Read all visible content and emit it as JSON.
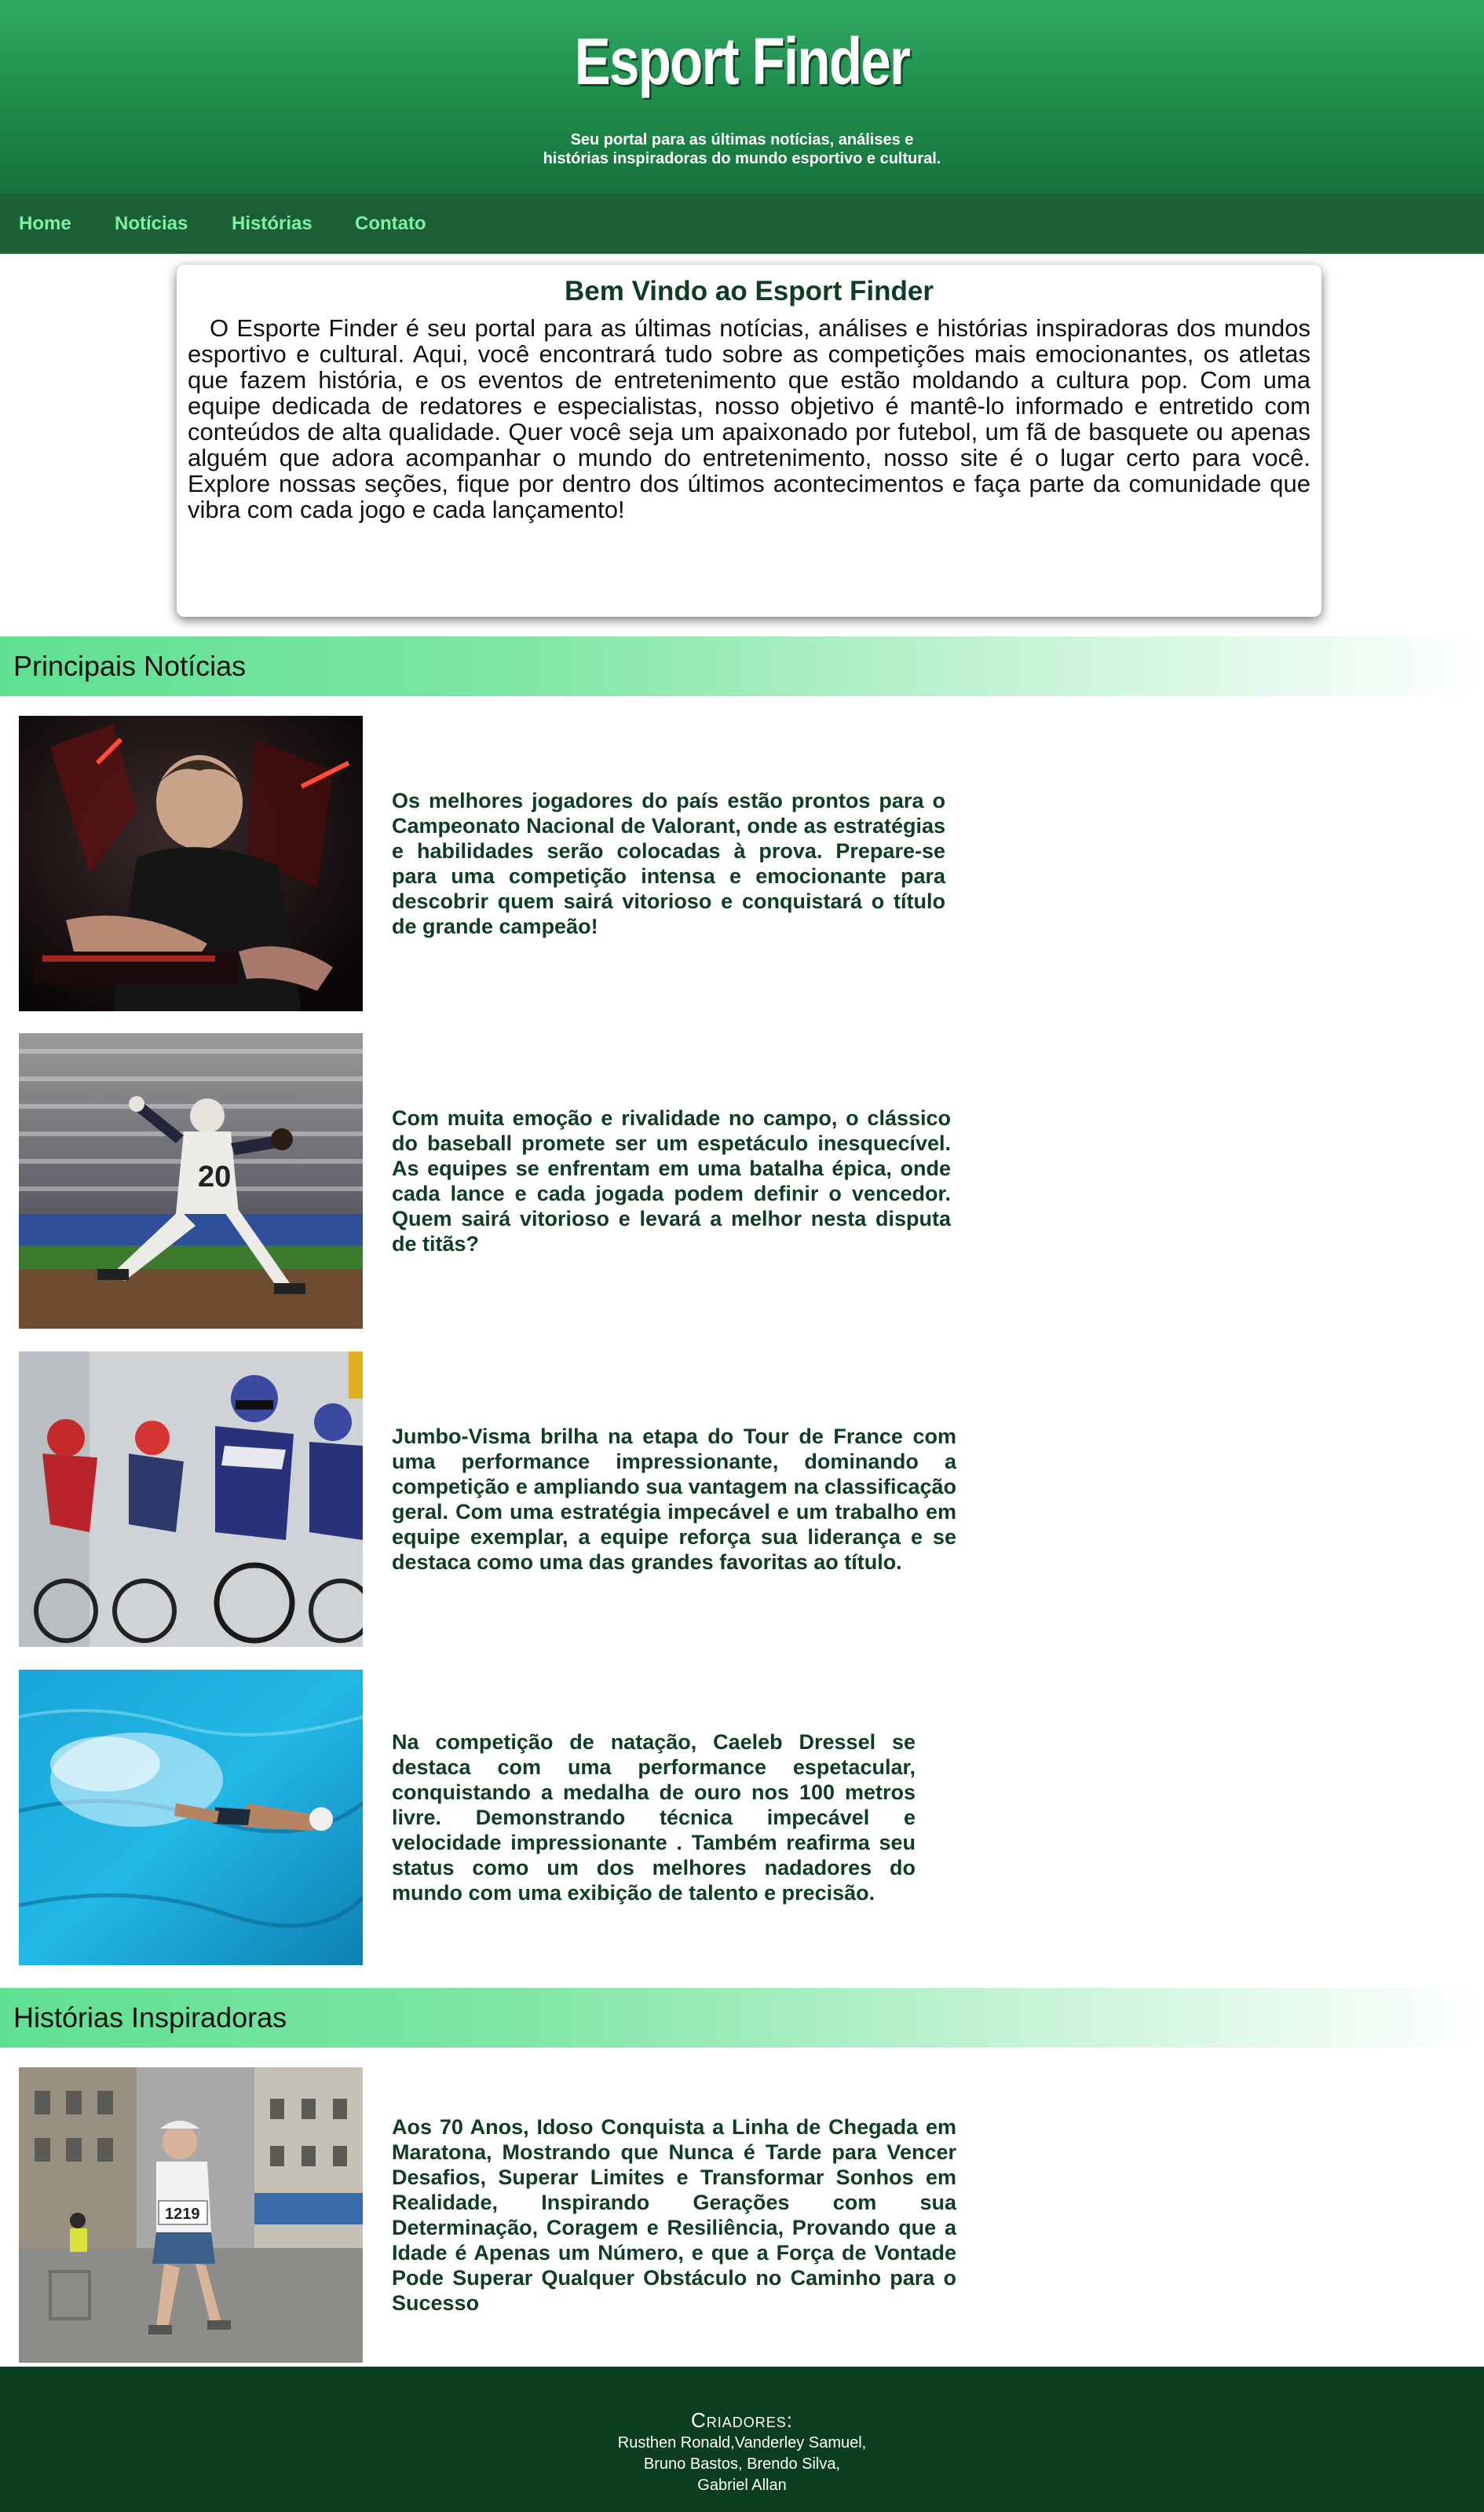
{
  "header": {
    "brand": "Esport Finder",
    "tagline_line1": "Seu portal para as últimas notícias, análises e",
    "tagline_line2": "histórias inspiradoras do mundo esportivo e cultural."
  },
  "nav": {
    "items": [
      "Home",
      "Notícias",
      "Histórias",
      "Contato"
    ]
  },
  "welcome": {
    "title": "Bem Vindo ao Esport Finder",
    "body": "O Esporte Finder é seu portal para as últimas notícias, análises e histórias inspiradoras dos mundos esportivo e cultural. Aqui, você encontrará tudo sobre as competições mais emocionantes, os atletas que fazem história, e os eventos de entretenimento que estão moldando a cultura pop. Com uma equipe dedicada de redatores e especialistas, nosso objetivo é mantê-lo informado e entretido com conteúdos de alta qualidade. Quer você seja um apaixonado por futebol, um fã de basquete ou apenas alguém que adora acompanhar o mundo do entretenimento, nosso site é o lugar certo para você. Explore nossas seções, fique por dentro dos últimos acontecimentos e faça parte da comunidade que vibra com cada jogo e cada lançamento!"
  },
  "news": {
    "title": "Principais Notícias",
    "items": [
      {
        "image": "esports-gamer-photo",
        "text": "Os melhores jogadores do país estão prontos para o Campeonato Nacional de Valorant, onde as estratégias e habilidades serão colocadas à prova. Prepare-se para uma competição intensa e emocionante para descobrir quem sairá vitorioso e conquistará o título de grande campeão!"
      },
      {
        "image": "baseball-pitcher-photo",
        "text": "Com muita emoção e rivalidade no campo, o clássico do baseball promete ser um espetáculo inesquecível. As equipes se enfrentam em uma batalha épica, onde cada lance e cada jogada podem definir o vencedor. Quem sairá vitorioso e levará a melhor nesta disputa de titãs?"
      },
      {
        "image": "cycling-peloton-photo",
        "text": "Jumbo-Visma brilha na etapa do Tour de France com uma performance impressionante, dominando a competição e ampliando sua vantagem na classificação geral. Com uma estratégia impecável e um trabalho em equipe exemplar, a equipe reforça sua liderança e se destaca como uma das grandes favoritas ao título."
      },
      {
        "image": "swimmer-pool-photo",
        "text": "Na competição de natação, Caeleb Dressel se destaca com uma performance espetacular, conquistando a medalha de ouro nos 100 metros livre. Demonstrando técnica impecável e velocidade impressionante . Também reafirma seu status como um dos melhores nadadores do mundo com uma exibição de talento e precisão."
      }
    ]
  },
  "stories": {
    "title": "Histórias Inspiradoras",
    "items": [
      {
        "image": "elderly-marathon-runner-photo",
        "text": "Aos 70 Anos, Idoso Conquista a Linha de Chegada em Maratona, Mostrando que Nunca é Tarde para Vencer Desafios, Superar Limites e Transformar Sonhos em Realidade, Inspirando Gerações com sua Determinação, Coragem e Resiliência, Provando que a Idade é Apenas um Número, e que a Força de Vontade Pode Superar Qualquer Obstáculo no Caminho para o Sucesso"
      }
    ]
  },
  "footer": {
    "title": "Criadores:",
    "line1": "Rusthen Ronald,Vanderley Samuel,",
    "line2": "Bruno Bastos, Brendo Silva,",
    "line3": "Gabriel Allan"
  },
  "colors": {
    "header_green": "#2faa63",
    "nav_green": "#1c5f37",
    "nav_link": "#7ef0a2",
    "article_text": "#0f3d22",
    "footer_bg": "#0b3d1f"
  }
}
